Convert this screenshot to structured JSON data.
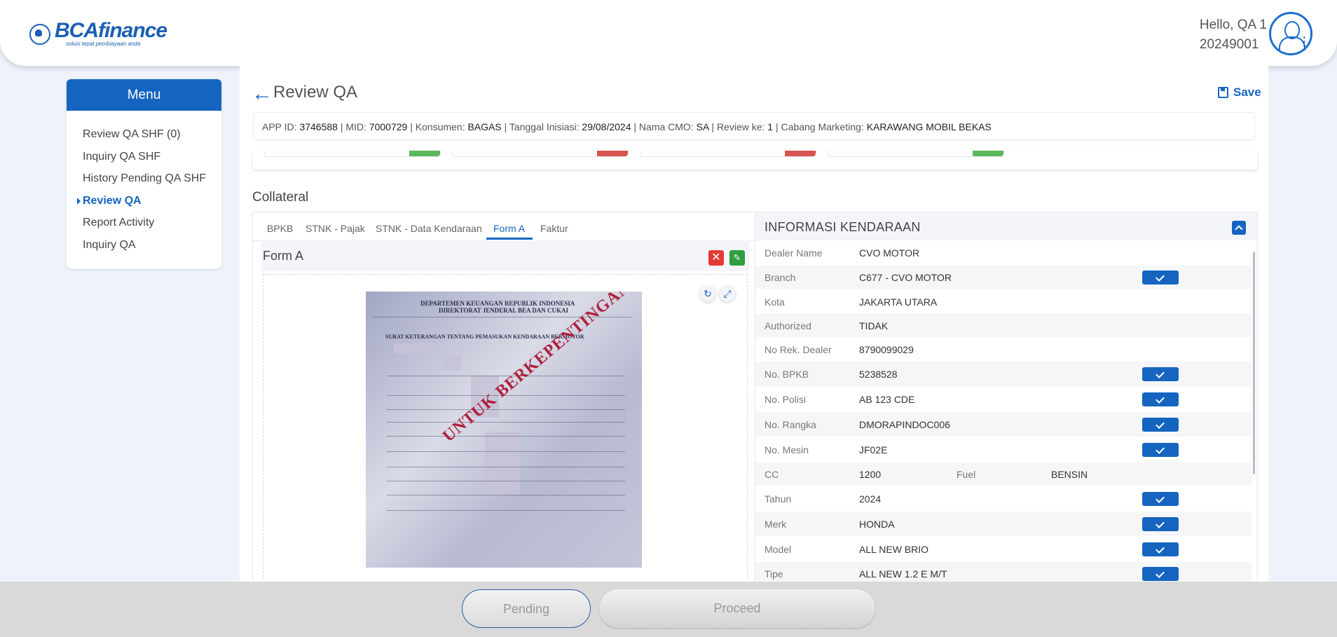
{
  "header": {
    "logo_text": "BCAfinance",
    "logo_tagline": "solusi tepat pembiayaan anda",
    "greeting": "Hello, QA 1",
    "user_id": "20249001"
  },
  "menu": {
    "title": "Menu",
    "items": [
      {
        "label": "Review QA SHF (0)",
        "active": false
      },
      {
        "label": "Inquiry QA SHF",
        "active": false
      },
      {
        "label": "History Pending QA SHF",
        "active": false
      },
      {
        "label": "Review QA",
        "active": true
      },
      {
        "label": "Report Activity",
        "active": false
      },
      {
        "label": "Inquiry QA",
        "active": false
      }
    ]
  },
  "page": {
    "title": "Review QA",
    "save_label": "Save"
  },
  "infobar": {
    "app_id_label": "APP ID:",
    "app_id": "3746588",
    "mid_label": "MID:",
    "mid": "7000729",
    "konsumen_label": "Konsumen:",
    "konsumen": "BAGAS",
    "tanggal_label": "Tanggal Inisiasi:",
    "tanggal": "29/08/2024",
    "cmo_label": "Nama CMO:",
    "cmo": "SA",
    "review_label": "Review ke:",
    "review": "1",
    "cabang_label": "Cabang Marketing:",
    "cabang": "KARAWANG MOBIL BEKAS"
  },
  "strip_tags": {
    "green": "#5cb85c",
    "red": "#d9534f"
  },
  "collateral": {
    "title": "Collateral",
    "tabs": [
      "BPKB",
      "STNK - Pajak",
      "STNK - Data Kendaraan",
      "Form A",
      "Faktur"
    ],
    "active_tab": "Form A",
    "form_title": "Form A",
    "document": {
      "heading1": "DEPARTEMEN KEUANGAN REPUBLIK INDONESIA",
      "heading2": "DIREKTORAT JENDERAL BEA DAN CUKAI",
      "subject": "SURAT KETERANGAN TENTANG PEMASUKAN KENDARAAN BERMOTOR",
      "stamp": "UNTUK BERKEPENTINGAN"
    }
  },
  "vehicle_info": {
    "title": "INFORMASI KENDARAAN",
    "rows": [
      {
        "label": "Dealer Name",
        "value": "CVO MOTOR",
        "checked": false
      },
      {
        "label": "Branch",
        "value": "C677 - CVO MOTOR",
        "checked": true
      },
      {
        "label": "Kota",
        "value": "JAKARTA UTARA",
        "checked": false
      },
      {
        "label": "Authorized",
        "value": "TIDAK",
        "checked": false
      },
      {
        "label": "No Rek. Dealer",
        "value": "8790099029",
        "checked": false
      },
      {
        "label": "No. BPKB",
        "value": "5238528",
        "checked": true
      },
      {
        "label": "No. Polisi",
        "value": "AB 123 CDE",
        "checked": true
      },
      {
        "label": "No. Rangka",
        "value": "DMORAPINDOC006",
        "checked": true
      },
      {
        "label": "No. Mesin",
        "value": "JF02E",
        "checked": true
      },
      {
        "label": "CC",
        "value": "1200",
        "label2": "Fuel",
        "value2": "BENSIN",
        "checked": false
      },
      {
        "label": "Tahun",
        "value": "2024",
        "checked": true
      },
      {
        "label": "Merk",
        "value": "HONDA",
        "checked": true
      },
      {
        "label": "Model",
        "value": "ALL NEW BRIO",
        "checked": true
      },
      {
        "label": "Tipe",
        "value": "ALL NEW 1.2 E M/T",
        "checked": true
      }
    ]
  },
  "footer": {
    "pending_label": "Pending",
    "proceed_label": "Proceed"
  }
}
